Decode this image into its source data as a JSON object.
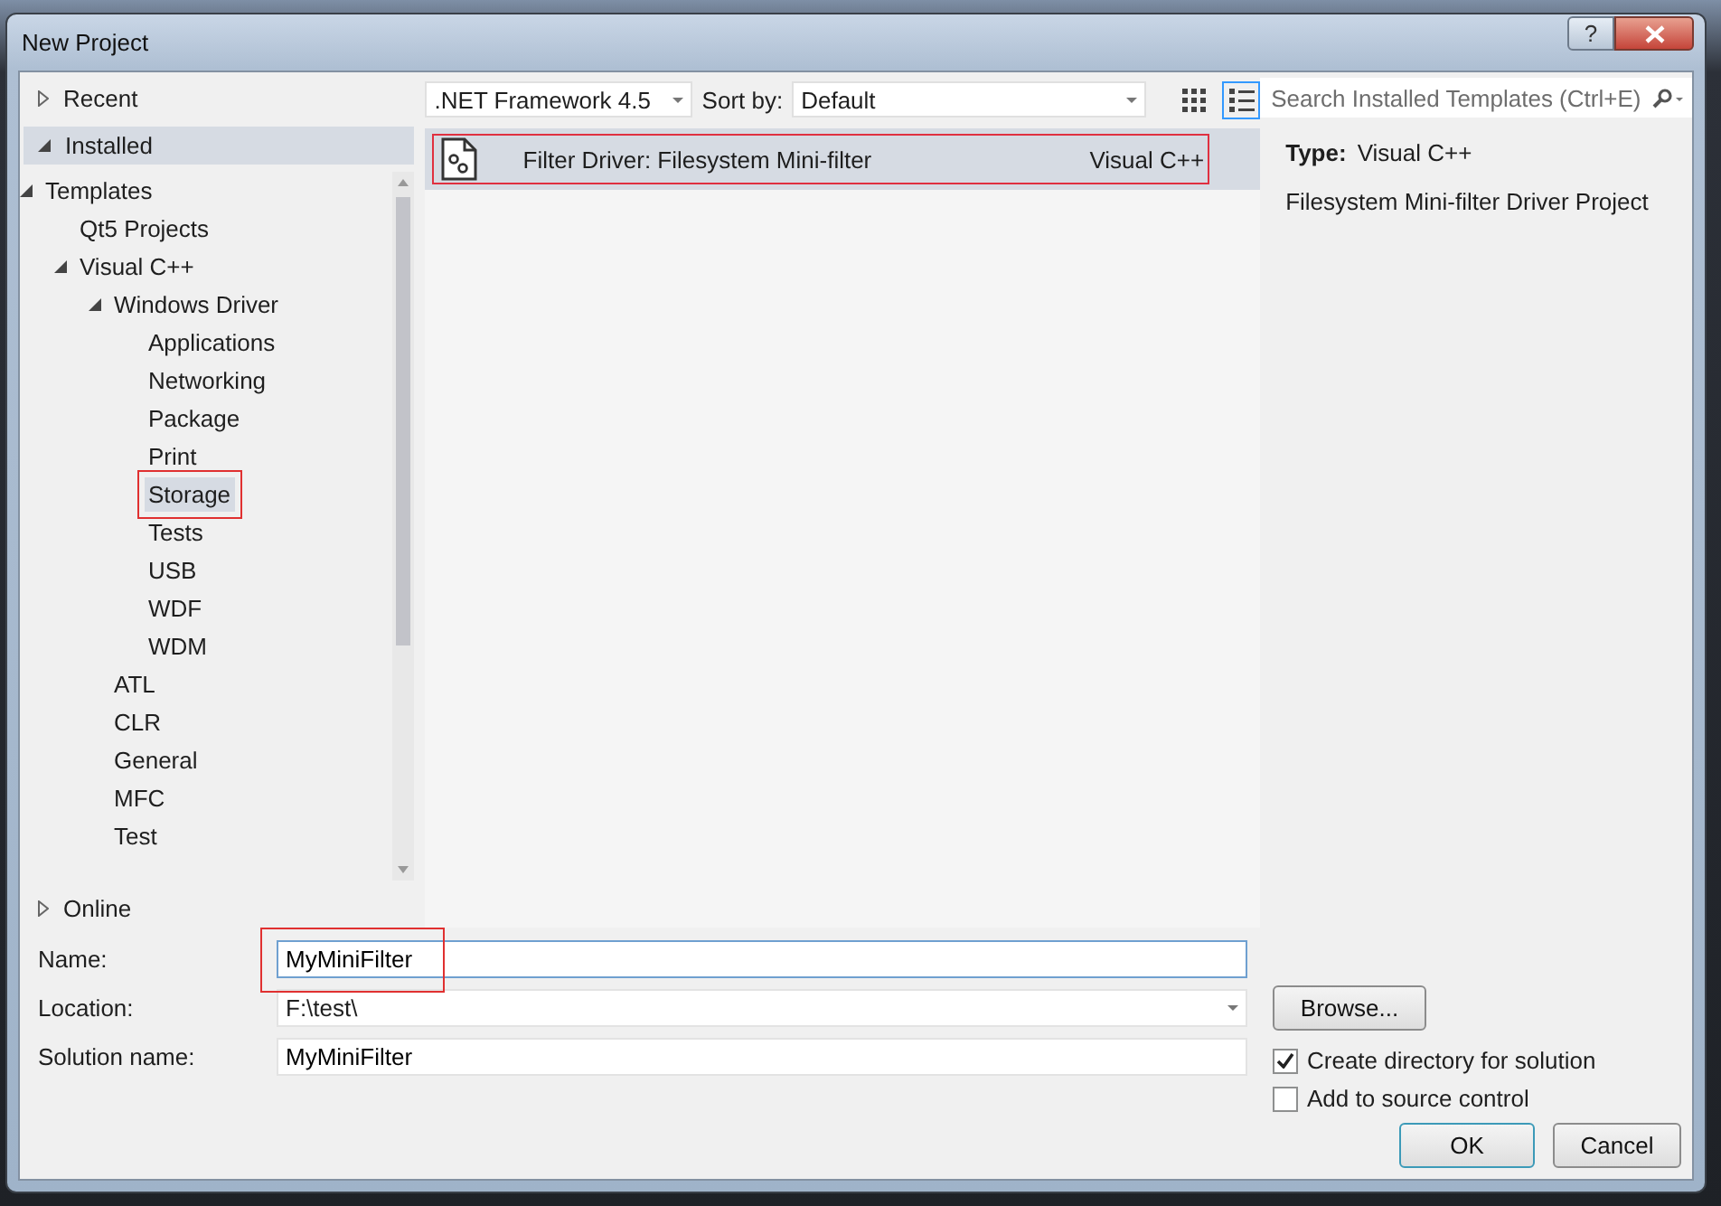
{
  "window": {
    "title": "New Project",
    "help_button": "?"
  },
  "sections": [
    {
      "label": "Recent",
      "expanded": false,
      "selected": false
    },
    {
      "label": "Installed",
      "expanded": true,
      "selected": true,
      "children": [
        {
          "label": "Templates",
          "expanded": true,
          "selected": false,
          "highlighted": false,
          "children": [
            {
              "label": "Qt5 Projects",
              "selected": false,
              "highlighted": false
            },
            {
              "label": "Visual C++",
              "expanded": true,
              "selected": false,
              "highlighted": false,
              "children": [
                {
                  "label": "Windows Driver",
                  "expanded": true,
                  "selected": false,
                  "highlighted": false,
                  "children": [
                    {
                      "label": "Applications",
                      "selected": false,
                      "highlighted": false
                    },
                    {
                      "label": "Networking",
                      "selected": false,
                      "highlighted": false
                    },
                    {
                      "label": "Package",
                      "selected": false,
                      "highlighted": false
                    },
                    {
                      "label": "Print",
                      "selected": false,
                      "highlighted": false
                    },
                    {
                      "label": "Storage",
                      "selected": true,
                      "highlighted": true
                    },
                    {
                      "label": "Tests",
                      "selected": false,
                      "highlighted": false
                    },
                    {
                      "label": "USB",
                      "selected": false,
                      "highlighted": false
                    },
                    {
                      "label": "WDF",
                      "selected": false,
                      "highlighted": false
                    },
                    {
                      "label": "WDM",
                      "selected": false,
                      "highlighted": false
                    }
                  ]
                },
                {
                  "label": "ATL",
                  "selected": false,
                  "highlighted": false
                },
                {
                  "label": "CLR",
                  "selected": false,
                  "highlighted": false
                },
                {
                  "label": "General",
                  "selected": false,
                  "highlighted": false
                },
                {
                  "label": "MFC",
                  "selected": false,
                  "highlighted": false
                },
                {
                  "label": "Test",
                  "selected": false,
                  "highlighted": false
                }
              ]
            }
          ]
        }
      ]
    },
    {
      "label": "Online",
      "expanded": false,
      "selected": false
    }
  ],
  "toolbar": {
    "framework": ".NET Framework 4.5",
    "sort_label": "Sort by:",
    "sort_value": "Default",
    "views": [
      {
        "kind": "grid",
        "selected": false
      },
      {
        "kind": "list",
        "selected": true
      }
    ]
  },
  "templates": [
    {
      "name": "Filter Driver: Filesystem Mini-filter",
      "language": "Visual C++",
      "selected": true,
      "highlighted": true
    }
  ],
  "search": {
    "placeholder": "Search Installed Templates (Ctrl+E)"
  },
  "details": {
    "type_label": "Type:",
    "type_value": "Visual C++",
    "description": "Filesystem Mini-filter Driver Project"
  },
  "form": [
    {
      "label": "Name:",
      "value": "MyMiniFilter",
      "kind": "text",
      "focused": true,
      "highlighted": true
    },
    {
      "label": "Location:",
      "value": "F:\\test\\",
      "kind": "dropdown",
      "focused": false
    },
    {
      "label": "Solution name:",
      "value": "MyMiniFilter",
      "kind": "text",
      "focused": false
    }
  ],
  "browse_button": "Browse...",
  "options": [
    {
      "label": "Create directory for solution",
      "checked": true
    },
    {
      "label": "Add to source control",
      "checked": false
    }
  ],
  "buttons": [
    {
      "label": "OK",
      "default": true
    },
    {
      "label": "Cancel",
      "default": false
    }
  ]
}
